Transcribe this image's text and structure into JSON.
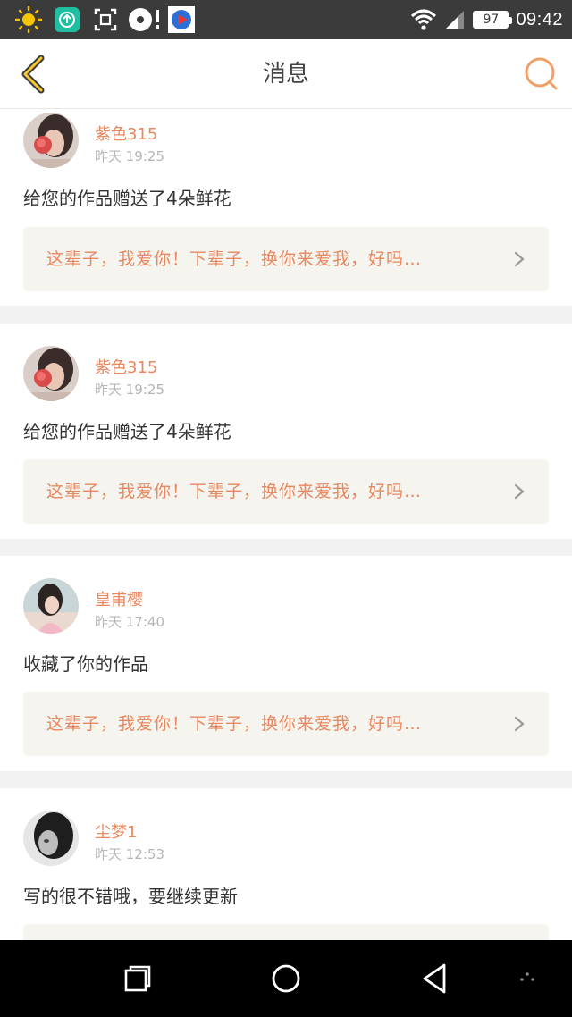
{
  "status_bar": {
    "battery": "97",
    "time": "09:42",
    "icons": [
      "sun-icon",
      "upload-app-icon",
      "scan-icon",
      "music-app-icon",
      "video-app-icon",
      "wifi-icon",
      "signal-icon",
      "battery-icon"
    ]
  },
  "header": {
    "title": "消息",
    "back_icon": "chevron-left-icon",
    "search_icon": "search-icon"
  },
  "messages": [
    {
      "username": "紫色315",
      "time": "昨天 19:25",
      "text": "给您的作品赠送了4朵鲜花",
      "quote": "这辈子，我爱你！下辈子，换你来爱我，好吗…"
    },
    {
      "username": "紫色315",
      "time": "昨天 19:25",
      "text": "给您的作品赠送了4朵鲜花",
      "quote": "这辈子，我爱你！下辈子，换你来爱我，好吗…"
    },
    {
      "username": "皇甫樱",
      "time": "昨天 17:40",
      "text": "收藏了你的作品",
      "quote": "这辈子，我爱你！下辈子，换你来爱我，好吗…"
    },
    {
      "username": "尘梦1",
      "time": "昨天 12:53",
      "text": "写的很不错哦，要继续更新",
      "quote": ""
    }
  ],
  "colors": {
    "accent": "#e9875e",
    "status_bar": "#3b3b3b",
    "quote_bg": "#f5f4ee",
    "nav_bar": "#000000"
  },
  "nav_bar": {
    "buttons": [
      "recent-apps-icon",
      "home-icon",
      "back-icon",
      "menu-dots-icon"
    ]
  }
}
